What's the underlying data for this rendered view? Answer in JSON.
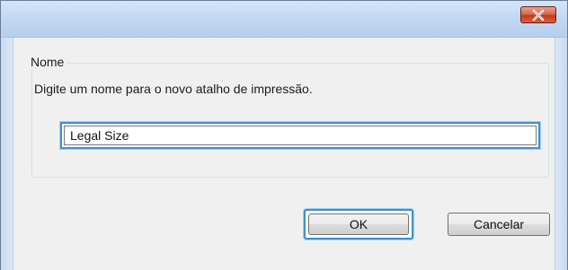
{
  "titlebar": {
    "close_icon": "close-icon",
    "close_color": "#c23b1f"
  },
  "group": {
    "legend": "Nome",
    "prompt": "Digite um nome para o novo atalho de impressão."
  },
  "name_input": {
    "value": "Legal Size"
  },
  "buttons": {
    "ok_label": "OK",
    "cancel_label": "Cancelar"
  }
}
